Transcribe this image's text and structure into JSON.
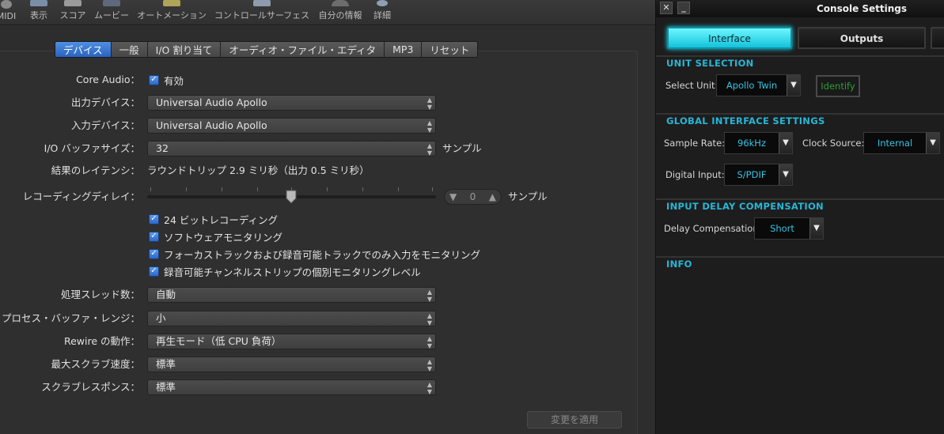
{
  "toolbar": {
    "items": [
      "MIDI",
      "表示",
      "スコア",
      "ムービー",
      "オートメーション",
      "コントロールサーフェス",
      "自分の情報",
      "詳細"
    ]
  },
  "tabs": [
    "デバイス",
    "一般",
    "I/O 割り当て",
    "オーディオ・ファイル・エディタ",
    "MP3",
    "リセット"
  ],
  "prefs": {
    "core_audio_label": "Core Audio：",
    "core_audio_value": "有効",
    "output_device_label": "出力デバイス：",
    "output_device_value": "Universal Audio Apollo",
    "input_device_label": "入力デバイス：",
    "input_device_value": "Universal Audio Apollo",
    "buffer_label": "I/O バッファサイズ：",
    "buffer_value": "32",
    "buffer_unit": "サンプル",
    "latency_label": "結果のレイテンシ：",
    "latency_value": "ラウンドトリップ 2.9 ミリ秒（出力 0.5 ミリ秒）",
    "rec_delay_label": "レコーディングディレイ：",
    "rec_delay_value": "0",
    "rec_delay_unit": "サンプル",
    "rec_delay_level": 0.5,
    "checkboxes": [
      "24 ビットレコーディング",
      "ソフトウェアモニタリング",
      "フォーカストラックおよび録音可能トラックでのみ入力をモニタリング",
      "録音可能チャンネルストリップの個別モニタリングレベル"
    ],
    "threads_label": "処理スレッド数：",
    "threads_value": "自動",
    "buffer_range_label": "プロセス・バッファ・レンジ：",
    "buffer_range_value": "小",
    "rewire_label": "Rewire の動作：",
    "rewire_value": "再生モード（低 CPU 負荷）",
    "scrub_speed_label": "最大スクラブ速度：",
    "scrub_speed_value": "標準",
    "scrub_response_label": "スクラブレスポンス：",
    "scrub_response_value": "標準",
    "apply_label": "変更を適用"
  },
  "console": {
    "title": "Console Settings",
    "close_glyph": "✕",
    "minimize_glyph": "_",
    "tabs": [
      "Interface",
      "Outputs"
    ],
    "unit_selection": "UNIT SELECTION",
    "select_unit_label": "Select Unit:",
    "select_unit_value": "Apollo Twin",
    "identify_label": "Identify",
    "global_settings": "GLOBAL INTERFACE SETTINGS",
    "sample_rate_label": "Sample Rate:",
    "sample_rate_value": "96kHz",
    "clock_source_label": "Clock Source:",
    "clock_source_value": "Internal",
    "digital_input_label": "Digital Input:",
    "digital_input_value": "S/PDIF",
    "delay_comp": "INPUT DELAY COMPENSATION",
    "delay_comp_label": "Delay Compensation:",
    "delay_comp_value": "Short",
    "info": "INFO",
    "accent": "#27b6d6"
  }
}
